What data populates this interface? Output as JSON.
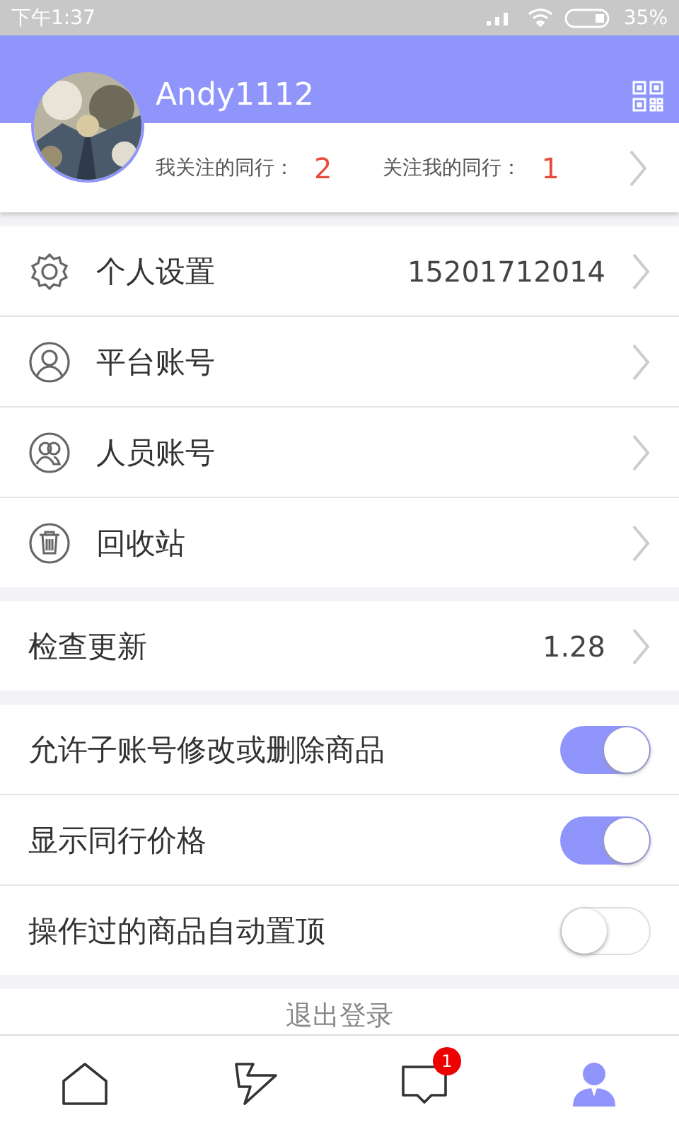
{
  "status_bar": {
    "time": "下午1:37",
    "battery": "35%"
  },
  "profile": {
    "username": "Andy1112",
    "following_label": "我关注的同行：",
    "following_count": "2",
    "followers_label": "关注我的同行：",
    "followers_count": "1"
  },
  "account_menu": [
    {
      "kind": "gear",
      "label": "个人设置",
      "value": "15201712014"
    },
    {
      "kind": "person",
      "label": "平台账号"
    },
    {
      "kind": "people",
      "label": "人员账号"
    },
    {
      "kind": "trash",
      "label": "回收站"
    }
  ],
  "update": {
    "label": "检查更新",
    "value": "1.28"
  },
  "toggles": [
    {
      "label": "允许子账号修改或删除商品",
      "on": true
    },
    {
      "label": "显示同行价格",
      "on": true
    },
    {
      "label": "操作过的商品自动置顶",
      "on": false
    }
  ],
  "logout": "退出登录",
  "tab_bar": [
    {
      "kind": "home",
      "selected": false
    },
    {
      "kind": "bolt",
      "selected": false
    },
    {
      "kind": "message",
      "selected": false,
      "badge": "1"
    },
    {
      "kind": "user",
      "selected": true
    }
  ]
}
